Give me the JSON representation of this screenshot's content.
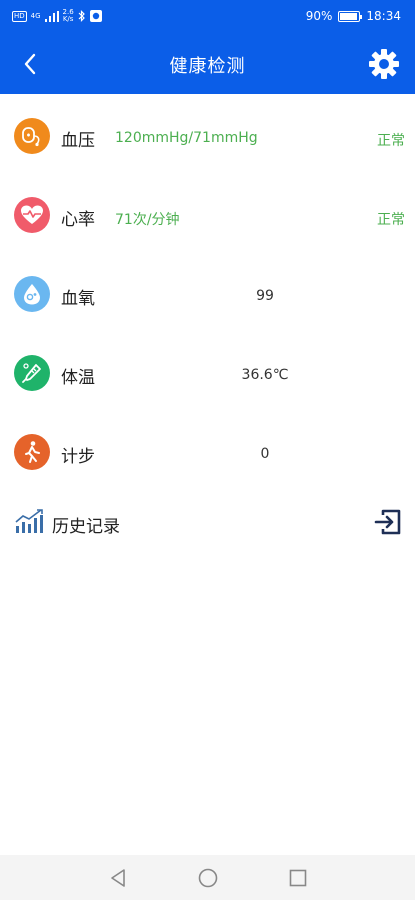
{
  "status_bar": {
    "hd": "HD",
    "signal_type": "4G",
    "net_speed_value": "2.6",
    "net_speed_unit": "K/s",
    "battery_percent": 90,
    "battery_text": "90%",
    "time": "18:34"
  },
  "header": {
    "title": "健康检测",
    "bg_color": "#0b5ee8"
  },
  "metrics": [
    {
      "label": "血压",
      "value": "120mmHg/71mmHg",
      "status": "正常",
      "icon": "blood-pressure-icon",
      "color": "#f08a1c"
    },
    {
      "label": "心率",
      "value": "71次/分钟",
      "status": "正常",
      "icon": "heart-rate-icon",
      "color": "#f05b6a"
    },
    {
      "label": "血氧",
      "value": "99",
      "icon": "blood-oxygen-icon",
      "color": "#6ab7f0"
    },
    {
      "label": "体温",
      "value": "36.6℃",
      "icon": "thermometer-icon",
      "color": "#1fb36a"
    },
    {
      "label": "计步",
      "value": "0",
      "icon": "walking-icon",
      "color": "#e5632a"
    }
  ],
  "history": {
    "label": "历史记录",
    "icon": "bar-chart-icon",
    "action_icon": "enter-icon"
  },
  "nav": {
    "back": "back-triangle-icon",
    "home": "home-circle-icon",
    "recent": "recent-square-icon"
  }
}
